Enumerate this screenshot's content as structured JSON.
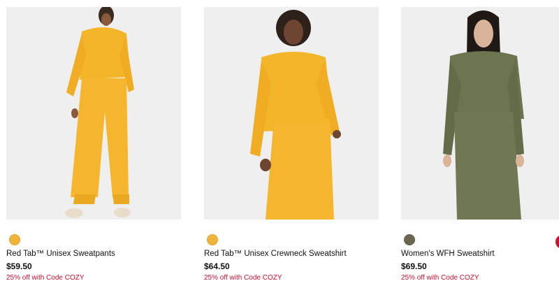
{
  "products": [
    {
      "name": "Red Tab™ Unisex Sweatpants",
      "price": "$59.50",
      "promo": "25% off with Code COZY",
      "swatch_color": "#f0b43a",
      "image_icon": "model-photo"
    },
    {
      "name": "Red Tab™ Unisex Crewneck Sweatshirt",
      "price": "$64.50",
      "promo": "25% off with Code COZY",
      "swatch_color": "#f0b43a",
      "image_icon": "model-photo"
    },
    {
      "name": "Women's WFH Sweatshirt",
      "price": "$69.50",
      "promo": "25% off with Code COZY",
      "swatch_color": "#6b6650",
      "image_icon": "model-photo"
    }
  ],
  "colors": {
    "yellow": "#f3b52a",
    "olive": "#6c7450",
    "promo_red": "#c41230"
  }
}
